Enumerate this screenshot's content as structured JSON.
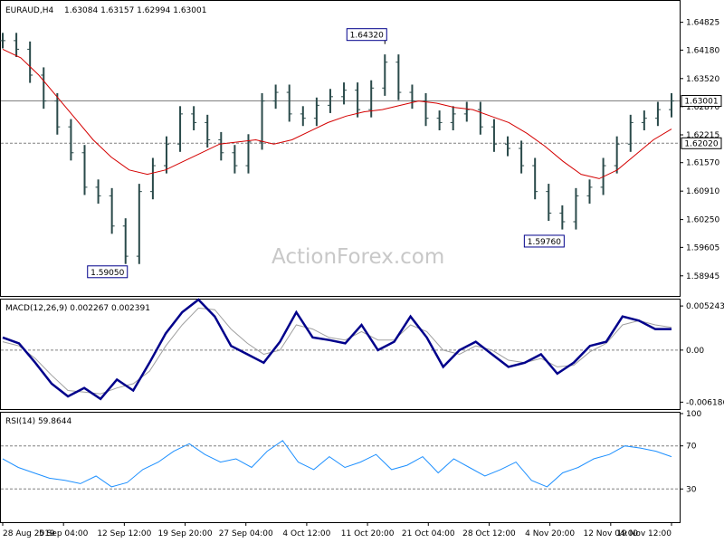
{
  "symbol_label": "EURAUD,H4",
  "ohlc_label": "1.63084 1.63157 1.62994 1.63001",
  "watermark": "ActionForex.com",
  "colors": {
    "price_bars": "#2a4a4a",
    "moving_average": "#d40000",
    "macd_line": "#00008b",
    "macd_signal": "#a0a0a0",
    "rsi_line": "#1e90ff",
    "level_line": "#808080",
    "frame": "#000000",
    "label_background": "#ffffff"
  },
  "chart_data": [
    {
      "type": "line",
      "pane": "price",
      "title": "EURAUD,H4 1.63084 1.63157 1.62994 1.63001",
      "x": [
        "28 Aug 2019",
        "5 Sep 04:00",
        "12 Sep 12:00",
        "19 Sep 20:00",
        "27 Sep 04:00",
        "4 Oct 12:00",
        "11 Oct 20:00",
        "21 Oct 04:00",
        "28 Oct 12:00",
        "4 Nov 20:00",
        "12 Nov 04:00",
        "19 Nov 12:00"
      ],
      "ylim": [
        1.585,
        1.653
      ],
      "yticks": [
        "1.64825",
        "1.64180",
        "1.63520",
        "1.62870",
        "1.62215",
        "1.61570",
        "1.60910",
        "1.60250",
        "1.59605",
        "1.58945"
      ],
      "series": [
        {
          "values": [
            1.644,
            1.642,
            1.636,
            1.63,
            1.624,
            1.618,
            1.61,
            1.608,
            1.601,
            1.594,
            1.609,
            1.615,
            1.62,
            1.627,
            1.625,
            1.621,
            1.618,
            1.615,
            1.6205,
            1.63,
            1.632,
            1.627,
            1.626,
            1.629,
            1.631,
            1.6325,
            1.628,
            1.633,
            1.639,
            1.632,
            1.63,
            1.626,
            1.625,
            1.627,
            1.628,
            1.624,
            1.62,
            1.619,
            1.615,
            1.609,
            1.604,
            1.602,
            1.608,
            1.61,
            1.615,
            1.62,
            1.625,
            1.626,
            1.628,
            1.63
          ]
        },
        {
          "values": [
            1.642,
            1.64,
            1.636,
            1.631,
            1.626,
            1.621,
            1.617,
            1.614,
            1.613,
            1.614,
            1.616,
            1.618,
            1.62,
            1.6205,
            1.621,
            1.62,
            1.621,
            1.623,
            1.625,
            1.6265,
            1.6275,
            1.628,
            1.629,
            1.63,
            1.6295,
            1.6285,
            1.628,
            1.6265,
            1.625,
            1.6225,
            1.6195,
            1.616,
            1.613,
            1.612,
            1.614,
            1.6175,
            1.621,
            1.6235
          ]
        }
      ],
      "annotations": [
        {
          "label": "1.59050",
          "value": 1.5905
        },
        {
          "label": "1.64320",
          "value": 1.6432
        },
        {
          "label": "1.59760",
          "value": 1.5976
        }
      ],
      "levels": [
        {
          "label": "1.63001",
          "value": 1.63001,
          "style": "solid"
        },
        {
          "label": "1.62020",
          "value": 1.6202,
          "style": "dashed"
        }
      ]
    },
    {
      "type": "line",
      "pane": "macd",
      "title": "MACD(12,26,9) 0.002267 0.002391",
      "ylim": [
        -0.0069,
        0.0059
      ],
      "yticks": [
        "0.005243",
        "0.00",
        "-0.006186"
      ],
      "series": [
        {
          "values": [
            0.0015,
            0.0008,
            -0.0015,
            -0.004,
            -0.0055,
            -0.0045,
            -0.0058,
            -0.0035,
            -0.0048,
            -0.0015,
            0.002,
            0.0045,
            0.006,
            0.004,
            0.0005,
            -0.0005,
            -0.0015,
            0.001,
            0.0045,
            0.0015,
            0.0012,
            0.0008,
            0.003,
            0.0,
            0.001,
            0.004,
            0.0015,
            -0.002,
            0.0,
            0.001,
            -0.0005,
            -0.002,
            -0.0015,
            -0.0005,
            -0.0028,
            -0.0015,
            0.0005,
            0.001,
            0.004,
            0.0035,
            0.0025,
            0.0025
          ]
        },
        {
          "values": [
            0.001,
            0.0005,
            -0.001,
            -0.003,
            -0.0048,
            -0.005,
            -0.0052,
            -0.0045,
            -0.004,
            -0.0025,
            0.0005,
            0.003,
            0.005,
            0.0048,
            0.0025,
            0.0008,
            -0.0005,
            0.0,
            0.003,
            0.0025,
            0.0015,
            0.0012,
            0.0022,
            0.0012,
            0.0012,
            0.003,
            0.0022,
            0.0,
            -0.0005,
            0.0005,
            0.0,
            -0.0012,
            -0.0015,
            -0.001,
            -0.002,
            -0.0018,
            -0.0002,
            0.0008,
            0.003,
            0.0035,
            0.003,
            0.0027
          ]
        }
      ]
    },
    {
      "type": "line",
      "pane": "rsi",
      "title": "RSI(14) 59.8644",
      "ylim": [
        0,
        100
      ],
      "yticks": [
        "100",
        "70",
        "30"
      ],
      "levels": [
        70,
        30
      ],
      "series": [
        {
          "values": [
            58,
            50,
            45,
            40,
            38,
            35,
            42,
            32,
            36,
            48,
            55,
            65,
            72,
            62,
            55,
            58,
            50,
            65,
            75,
            55,
            48,
            60,
            50,
            55,
            62,
            48,
            52,
            60,
            45,
            58,
            50,
            42,
            48,
            55,
            38,
            32,
            45,
            50,
            58,
            62,
            70,
            68,
            65,
            60
          ]
        }
      ]
    }
  ]
}
